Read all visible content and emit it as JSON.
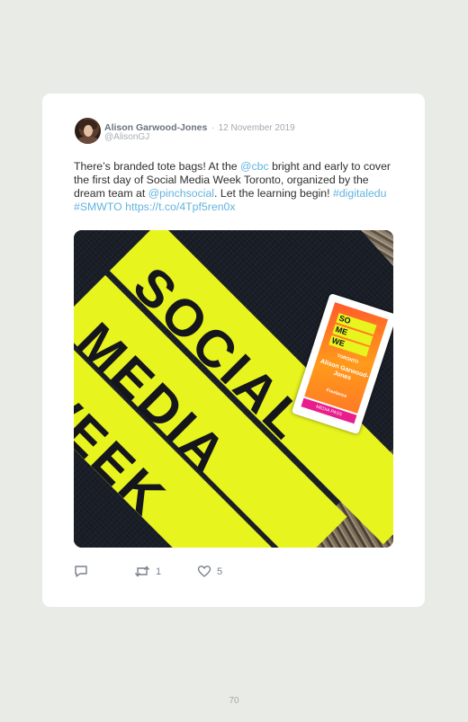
{
  "tweet": {
    "author": "Alison Garwood-Jones",
    "separator": "·",
    "date": "12 November 2019",
    "handle": "@AlisonGJ",
    "text": {
      "p1": "There’s branded tote bags! At the ",
      "mention1": "@cbc",
      "p2": " bright and early to cover the first day of Social Media Week Toronto, organized by the dream team at ",
      "mention2": "@pinchsocial",
      "p3": ". Let the learning begin! ",
      "hashtag1": "#digitaledu",
      "space": " ",
      "hashtag2": "#SMWTO",
      "space2": " ",
      "url": "https://t.co/4Tpf5ren0x"
    },
    "photo": {
      "bag_line1": "SOCIAL",
      "bag_line2": "MEDIA",
      "bag_line3": "WEEK",
      "pass_logo": [
        "SO",
        "ME",
        "WE"
      ],
      "pass_sub": "TORONTO",
      "pass_name": "Alison Garwood-Jones",
      "pass_role": "Freelance",
      "pass_strip": "MEDIA PASS"
    },
    "actions": {
      "reply_icon": "reply-icon",
      "retweet_icon": "retweet-icon",
      "retweet_count": "1",
      "like_icon": "heart-icon",
      "like_count": "5"
    }
  },
  "colors": {
    "link": "#62b3de",
    "page_bg": "#e9ebe6",
    "bag_yellow": "#e8f41e"
  },
  "page_number": "70"
}
